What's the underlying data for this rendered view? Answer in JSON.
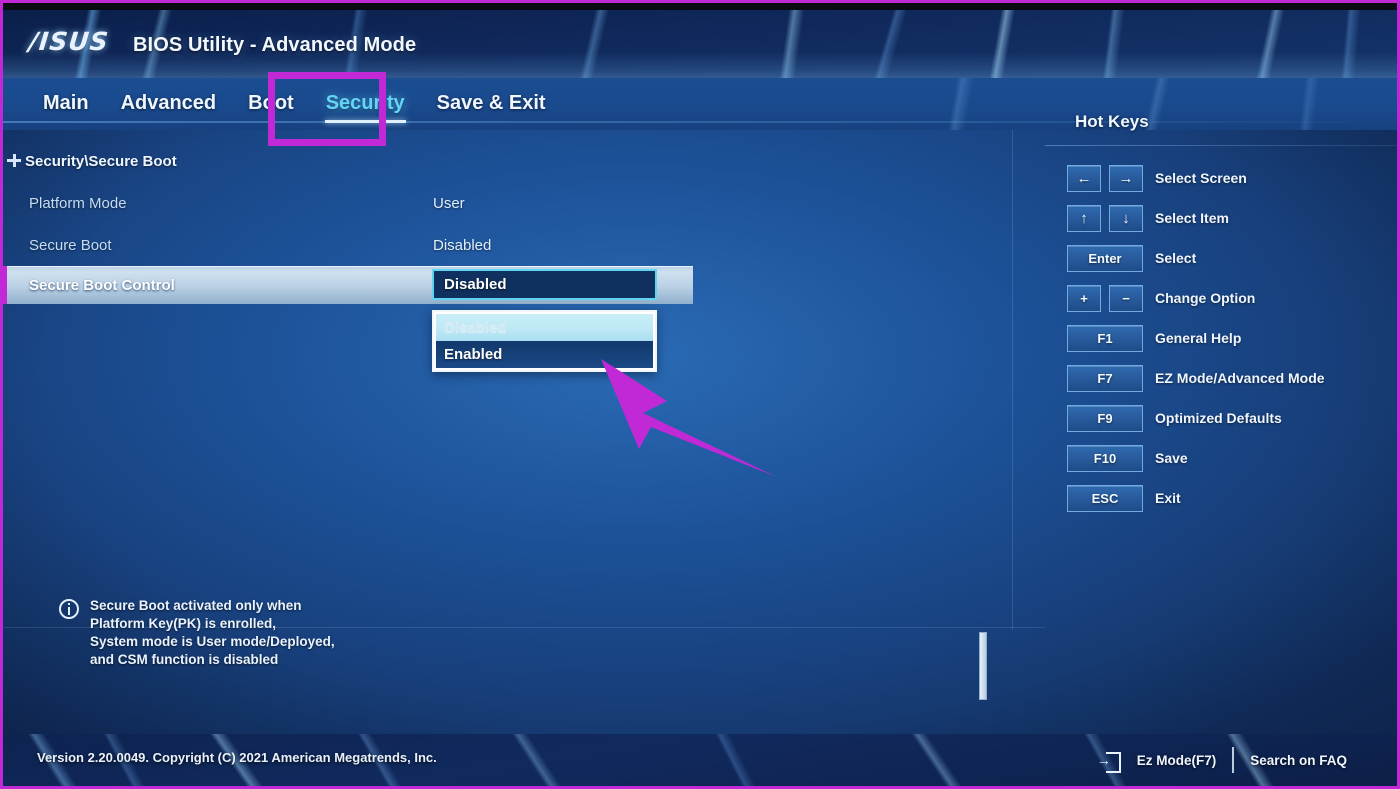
{
  "window": {
    "brand_logo": "asus-logo",
    "brand_text": "/ISUS",
    "title": "BIOS Utility - Advanced Mode"
  },
  "tabs": [
    {
      "label": "Main",
      "active": false
    },
    {
      "label": "Advanced",
      "active": false
    },
    {
      "label": "Boot",
      "active": false
    },
    {
      "label": "Security",
      "active": true
    },
    {
      "label": "Save & Exit",
      "active": false
    }
  ],
  "content": {
    "breadcrumb": "Security\\Secure Boot",
    "settings": [
      {
        "label": "Platform Mode",
        "value": "User",
        "selected": false
      },
      {
        "label": "Secure Boot",
        "value": "Disabled",
        "selected": false
      }
    ],
    "selected_setting": {
      "label": "Secure Boot Control",
      "value": "Disabled"
    },
    "dropdown": {
      "open": true,
      "options": [
        {
          "label": "Disabled",
          "state": "current"
        },
        {
          "label": "Enabled",
          "state": "other"
        }
      ]
    }
  },
  "help": {
    "icon": "info-icon",
    "lines": [
      "Secure Boot activated only when",
      "Platform Key(PK) is enrolled,",
      "System mode is User mode/Deployed,",
      "and CSM function is disabled"
    ]
  },
  "hotkeys": {
    "title": "Hot Keys",
    "items": [
      {
        "keys": [
          "←",
          "→"
        ],
        "wide": false,
        "description": "Select Screen"
      },
      {
        "keys": [
          "↑",
          "↓"
        ],
        "wide": false,
        "description": "Select Item"
      },
      {
        "keys": [
          "Enter"
        ],
        "wide": true,
        "description": "Select"
      },
      {
        "keys": [
          "+",
          "−"
        ],
        "wide": false,
        "description": "Change Option"
      },
      {
        "keys": [
          "F1"
        ],
        "wide": true,
        "description": "General Help"
      },
      {
        "keys": [
          "F7"
        ],
        "wide": true,
        "description": "EZ Mode/Advanced Mode"
      },
      {
        "keys": [
          "F9"
        ],
        "wide": true,
        "description": "Optimized Defaults"
      },
      {
        "keys": [
          "F10"
        ],
        "wide": true,
        "description": "Save"
      },
      {
        "keys": [
          "ESC"
        ],
        "wide": true,
        "description": "Exit"
      }
    ]
  },
  "footer": {
    "version": "Version 2.20.0049. Copyright (C) 2021 American Megatrends, Inc.",
    "ez_mode_label": "Ez Mode(F7)",
    "search_label": "Search on FAQ"
  },
  "annotations": {
    "highlight_color": "#c229d6",
    "box_target": "Security tab",
    "arrow_target": "Enabled option"
  },
  "colors": {
    "accent_cyan": "#63d4f7",
    "annotation_magenta": "#c229d6",
    "panel_blue": "#1d5299",
    "header_navy": "#10295c"
  }
}
